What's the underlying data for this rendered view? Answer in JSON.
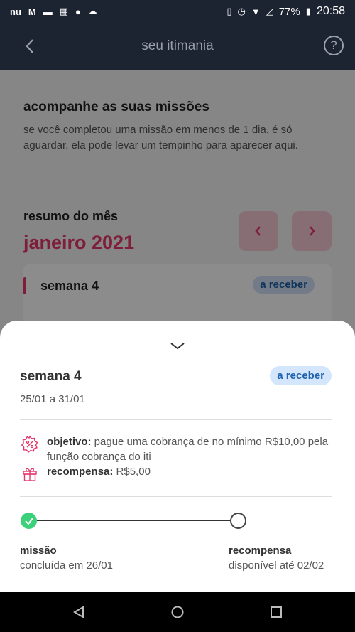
{
  "status_bar": {
    "battery": "77%",
    "time": "20:58"
  },
  "header": {
    "title": "seu itimania",
    "help_symbol": "?"
  },
  "background": {
    "heading": "acompanhe as suas missões",
    "description": "se você completou uma missão em menos de 1 dia, é só aguardar, ela pode levar um tempinho para aparecer aqui.",
    "summary_label": "resumo do mês",
    "month": "janeiro 2021",
    "week_card": {
      "title": "semana 4",
      "badge": "a receber"
    }
  },
  "sheet": {
    "title": "semana 4",
    "badge": "a receber",
    "dates": "25/01 a 31/01",
    "objective_label": "objetivo:",
    "objective_text": " pague uma cobrança de no mínimo R$10,00 pela função cobrança do iti",
    "reward_label": "recompensa:",
    "reward_text": " R$5,00",
    "steps": [
      {
        "title": "missão",
        "subtitle": "concluída em 26/01"
      },
      {
        "title": "recompensa",
        "subtitle": "disponível até 02/02"
      }
    ]
  },
  "colors": {
    "brand_pink": "#e5376b",
    "badge_bg": "#d3e6fb",
    "badge_text": "#1f63ae",
    "success_green": "#3bd07a",
    "header_bg": "#1c2331"
  },
  "icons": [
    "back-arrow-icon",
    "help-icon",
    "chevron-left-icon",
    "chevron-right-icon",
    "chevron-down-icon",
    "badge-percent-icon",
    "gift-icon",
    "check-icon",
    "nav-back-icon",
    "nav-home-icon",
    "nav-recents-icon"
  ]
}
